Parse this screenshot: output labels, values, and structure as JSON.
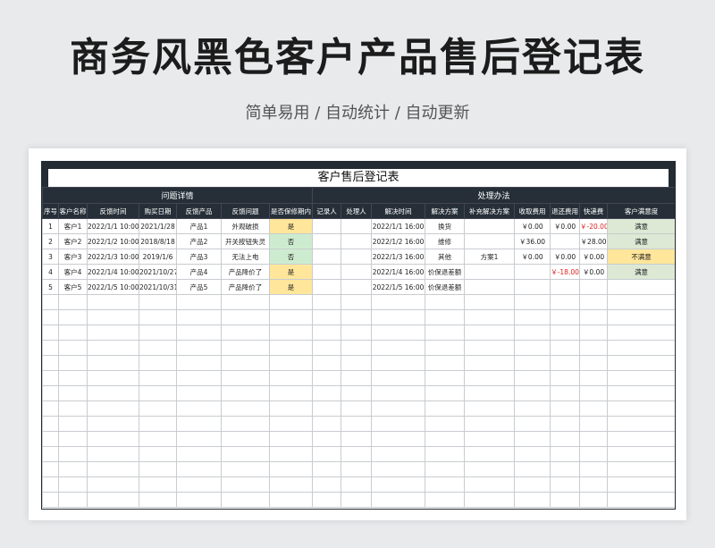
{
  "hero": {
    "title": "商务风黑色客户产品售后登记表",
    "subtitle": "简单易用 / 自动统计 / 自动更新"
  },
  "sheet": {
    "title": "客户售后登记表",
    "group_left": "问题详情",
    "group_right": "处理办法",
    "columns": [
      "序号",
      "客户名称",
      "反馈时间",
      "购买日期",
      "反馈产品",
      "反馈问题",
      "是否保修期内",
      "记录人",
      "处理人",
      "解决时间",
      "解决方案",
      "补充解决方案",
      "收取费用",
      "退还费用",
      "快递费",
      "客户满意度"
    ],
    "rows": [
      [
        "1",
        "客户1",
        "2022/1/1 10:00",
        "2021/1/28",
        "产品1",
        "外观破损",
        "是",
        "",
        "",
        "2022/1/1 16:00",
        "换货",
        "",
        "￥0.00",
        "￥0.00",
        "￥-20.00",
        "满意"
      ],
      [
        "2",
        "客户2",
        "2022/1/2 10:00",
        "2018/8/18",
        "产品2",
        "开关按钮失灵",
        "否",
        "",
        "",
        "2022/1/2 16:00",
        "维修",
        "",
        "￥36.00",
        "",
        "￥28.00",
        "满意"
      ],
      [
        "3",
        "客户3",
        "2022/1/3 10:00",
        "2019/1/6",
        "产品3",
        "无法上电",
        "否",
        "",
        "",
        "2022/1/3 16:00",
        "其他",
        "方案1",
        "￥0.00",
        "￥0.00",
        "￥0.00",
        "不满意"
      ],
      [
        "4",
        "客户4",
        "2022/1/4 10:00",
        "2021/10/27",
        "产品4",
        "产品降价了",
        "是",
        "",
        "",
        "2022/1/4 16:00",
        "价保退差额",
        "",
        "",
        "￥-18.00",
        "￥0.00",
        "满意"
      ],
      [
        "5",
        "客户5",
        "2022/1/5 10:00",
        "2021/10/31",
        "产品5",
        "产品降价了",
        "是",
        "",
        "",
        "2022/1/5 16:00",
        "价保退差额",
        "",
        "",
        "",
        "",
        ""
      ]
    ],
    "empty_row_count": 14
  }
}
